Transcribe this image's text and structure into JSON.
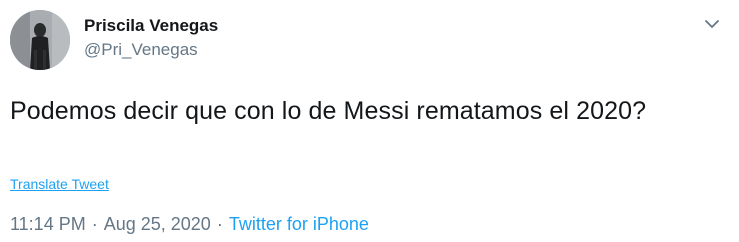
{
  "user": {
    "display_name": "Priscila Venegas",
    "handle": "@Pri_Venegas",
    "avatar": "avatar-photo"
  },
  "menu": {
    "icon": "chevron-down-icon"
  },
  "tweet": {
    "text": "Podemos decir que con lo de Messi rematamos el 2020?",
    "translate_label": "Translate Tweet"
  },
  "meta": {
    "time": "11:14 PM",
    "separator": "·",
    "date": "Aug 25, 2020",
    "source": "Twitter for iPhone"
  },
  "colors": {
    "link": "#1da1f2",
    "secondary_text": "#657786",
    "primary_text": "#14171a"
  }
}
